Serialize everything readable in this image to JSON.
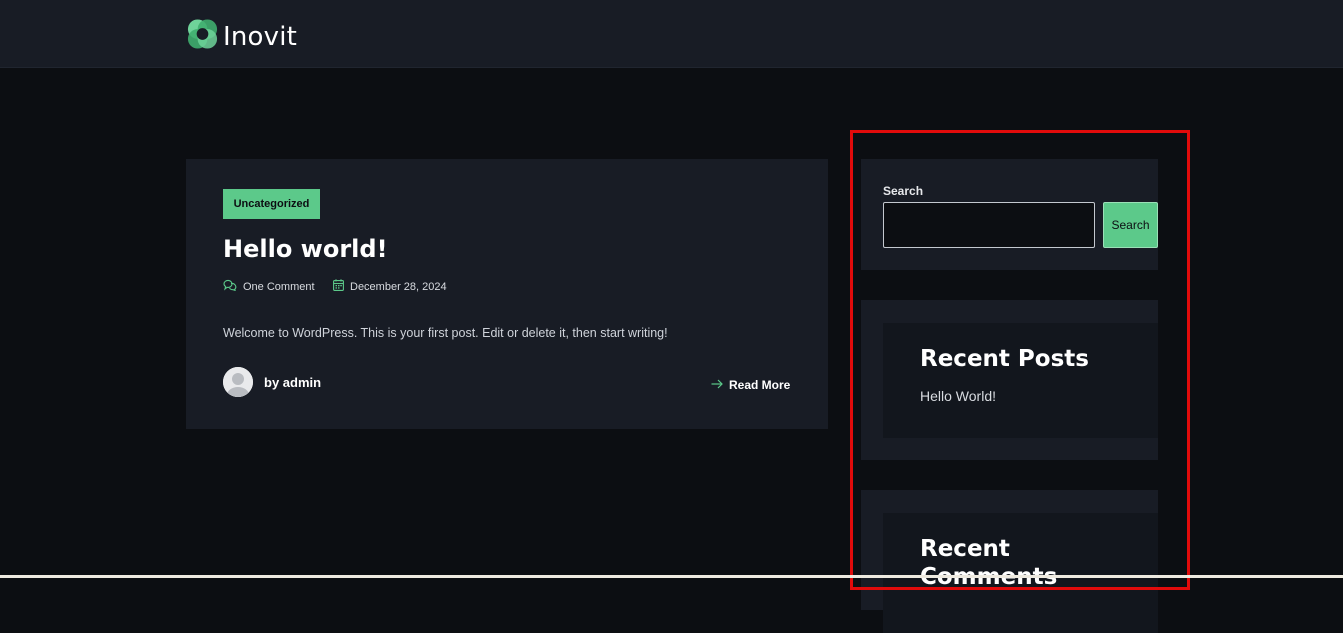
{
  "header": {
    "site_name": "Inovit",
    "logo_icon": "inovit-logo-icon"
  },
  "post": {
    "category": "Uncategorized",
    "title": "Hello world!",
    "comments": "One Comment",
    "date": "December 28, 2024",
    "excerpt": "Welcome to WordPress. This is your first post. Edit or delete it, then start writing!",
    "author": "by admin",
    "read_more": "Read More"
  },
  "sidebar": {
    "search": {
      "label": "Search",
      "placeholder": "",
      "value": "",
      "button": "Search"
    },
    "recent_posts": {
      "title": "Recent Posts",
      "items": [
        "Hello World!"
      ]
    },
    "recent_comments": {
      "title": "Recent Comments"
    }
  },
  "colors": {
    "accent": "#5cc98a",
    "background": "#0c0e12",
    "card": "#181c25",
    "highlight": "#e10b0b"
  }
}
